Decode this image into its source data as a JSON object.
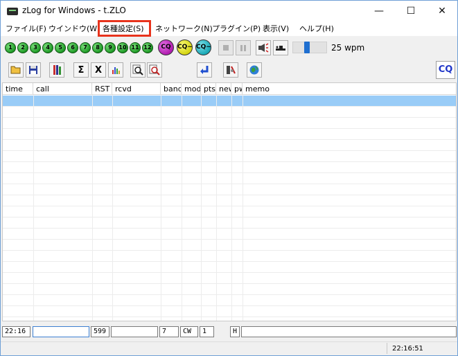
{
  "window": {
    "title": "zLog for Windows  - t.ZLO",
    "minimize": "—",
    "maximize": "☐",
    "close": "✕"
  },
  "menu": {
    "items": [
      {
        "label": "ファイル(F)"
      },
      {
        "label": "ウインドウ(W)"
      },
      {
        "label": "各種設定(S)"
      },
      {
        "label": "ネットワーク(N)"
      },
      {
        "label": "プラグイン(P)"
      },
      {
        "label": "表示(V)"
      },
      {
        "label": "ヘルプ(H)"
      }
    ],
    "highlight_color": "#e8331c"
  },
  "toolbar": {
    "cw_keys": [
      "1",
      "2",
      "3",
      "4",
      "5",
      "6",
      "7",
      "8",
      "9",
      "10",
      "11",
      "12"
    ],
    "cq_buttons": [
      {
        "label": "CQ",
        "color": "#b01cb0"
      },
      {
        "label": "CQ~",
        "color": "#d4d410"
      },
      {
        "label": "CQ~",
        "color": "#19a8b6"
      }
    ],
    "speed_label": "25 wpm",
    "speed_value": 25,
    "cq_mode_label": "CQ",
    "icons": [
      "open-folder-icon",
      "save-icon",
      "book-icon",
      "sigma-icon",
      "x-icon",
      "bar-chart-icon",
      "zoom-in-icon",
      "zoom-out-icon",
      "return-icon",
      "settings-icon",
      "globe-icon"
    ]
  },
  "grid": {
    "columns": [
      "time",
      "call",
      "RST",
      "rcvd",
      "band",
      "mod",
      "pts",
      "new",
      "pw",
      "memo"
    ],
    "rows_visible": 20
  },
  "entry": {
    "time": "22:16",
    "call": "",
    "rst": "599",
    "rcvd": "",
    "band": "7",
    "mode": "CW",
    "pts": "1",
    "power": "H",
    "memo": ""
  },
  "status": {
    "clock": "22:16:51"
  },
  "colors": {
    "selected_row": "#99ccf7",
    "accent": "#2036c8"
  }
}
